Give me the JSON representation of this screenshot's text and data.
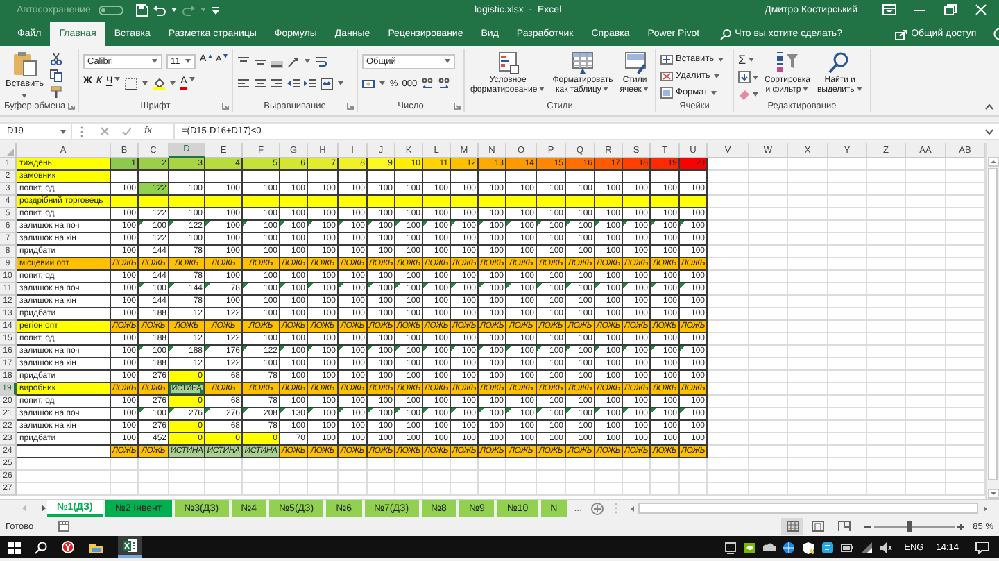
{
  "title_bar": {
    "autosave_label": "Автосохранение",
    "autosave_on": false,
    "document_title": "logistic.xlsx  -  Excel",
    "user_name": "Дмитро Костирський"
  },
  "menu_tabs": [
    {
      "label": "Файл",
      "selected": false
    },
    {
      "label": "Главная",
      "selected": true
    },
    {
      "label": "Вставка",
      "selected": false
    },
    {
      "label": "Разметка страницы",
      "selected": false
    },
    {
      "label": "Формулы",
      "selected": false
    },
    {
      "label": "Данные",
      "selected": false
    },
    {
      "label": "Рецензирование",
      "selected": false
    },
    {
      "label": "Вид",
      "selected": false
    },
    {
      "label": "Разработчик",
      "selected": false
    },
    {
      "label": "Справка",
      "selected": false
    },
    {
      "label": "Power Pivot",
      "selected": false
    }
  ],
  "tell_me": {
    "placeholder": "Что вы хотите сделать?"
  },
  "share_button": "Общий доступ",
  "ribbon": {
    "clipboard": {
      "paste": "Вставить",
      "label": "Буфер обмена"
    },
    "font": {
      "name": "Calibri",
      "size": "11",
      "grow": "A",
      "shrink": "A",
      "bold": "Ж",
      "italic": "К",
      "underline": "Ч",
      "font_color": "A",
      "label": "Шрифт"
    },
    "alignment": {
      "label": "Выравнивание"
    },
    "number": {
      "format": "Общий",
      "percent": "%",
      "thousands": "000",
      "label": "Число"
    },
    "styles": {
      "buttons": [
        "Условное\nформатирование",
        "Форматировать\nкак таблицу",
        "Стили\nячеек"
      ],
      "label": "Стили"
    },
    "cells": {
      "buttons": [
        "Вставить",
        "Удалить",
        "Формат"
      ],
      "label": "Ячейки"
    },
    "editing": {
      "sum": "Σ",
      "buttons": [
        "Сортировка\nи фильтр",
        "Найти и\nвыделить"
      ],
      "label": "Редактирование"
    }
  },
  "formula_bar": {
    "name_box": "D19",
    "fx": "fx",
    "formula": "=(D15-D16+D17)<0"
  },
  "sheet": {
    "columns": [
      {
        "label": "A",
        "selected": false
      },
      {
        "label": "B",
        "selected": false
      },
      {
        "label": "C",
        "selected": false
      },
      {
        "label": "D",
        "selected": true
      },
      {
        "label": "E",
        "selected": false
      },
      {
        "label": "F",
        "selected": false
      },
      {
        "label": "G",
        "selected": false
      },
      {
        "label": "H",
        "selected": false
      },
      {
        "label": "I",
        "selected": false
      },
      {
        "label": "J",
        "selected": false
      },
      {
        "label": "K",
        "selected": false
      },
      {
        "label": "L",
        "selected": false
      },
      {
        "label": "M",
        "selected": false
      },
      {
        "label": "N",
        "selected": false
      },
      {
        "label": "O",
        "selected": false
      },
      {
        "label": "P",
        "selected": false
      },
      {
        "label": "Q",
        "selected": false
      },
      {
        "label": "R",
        "selected": false
      },
      {
        "label": "S",
        "selected": false
      },
      {
        "label": "T",
        "selected": false
      },
      {
        "label": "U",
        "selected": false
      },
      {
        "label": "V",
        "selected": false
      },
      {
        "label": "W",
        "selected": false
      },
      {
        "label": "X",
        "selected": false
      },
      {
        "label": "Y",
        "selected": false
      },
      {
        "label": "Z",
        "selected": false
      },
      {
        "label": "AA",
        "selected": false
      },
      {
        "label": "AB",
        "selected": false
      }
    ],
    "rows": [
      {
        "number": "1",
        "selected": false,
        "kind": "header",
        "label": {
          "text": "тиждень",
          "color": "#ffff00"
        },
        "cells": [
          {
            "text": "1",
            "color": "#8dc94e"
          },
          {
            "text": "2",
            "color": "#9bcf48"
          },
          {
            "text": "3",
            "color": "#a9d543"
          },
          {
            "text": "4",
            "color": "#b8db3d"
          },
          {
            "text": "5",
            "color": "#c6e138"
          },
          {
            "text": "6",
            "color": "#d4e632"
          },
          {
            "text": "7",
            "color": "#e2ec2d"
          },
          {
            "text": "8",
            "color": "#f0f227"
          },
          {
            "text": "9",
            "color": "#fef822"
          },
          {
            "text": "10",
            "color": "#ffee00"
          },
          {
            "text": "11",
            "color": "#ffd400"
          },
          {
            "text": "12",
            "color": "#ffc000"
          },
          {
            "text": "13",
            "color": "#ffaa00"
          },
          {
            "text": "14",
            "color": "#ff9900"
          },
          {
            "text": "15",
            "color": "#ff8800"
          },
          {
            "text": "16",
            "color": "#ff7000"
          },
          {
            "text": "17",
            "color": "#ff5a00"
          },
          {
            "text": "18",
            "color": "#ff4000"
          },
          {
            "text": "19",
            "color": "#ff2a00"
          },
          {
            "text": "20",
            "color": "#ff0000"
          }
        ]
      },
      {
        "number": "2",
        "selected": false,
        "kind": "section",
        "label": {
          "text": "замовник",
          "color": "#ffff00"
        }
      },
      {
        "number": "3",
        "selected": false,
        "kind": "data",
        "label": "попит, од",
        "cells": [
          "100",
          {
            "text": "122",
            "color": "#92d050"
          },
          "100",
          "100",
          "100",
          "100",
          "100",
          "100",
          "100",
          "100",
          "100",
          "100",
          "100",
          "100",
          "100",
          "100",
          "100",
          "100",
          "100",
          "100"
        ]
      },
      {
        "number": "4",
        "selected": false,
        "kind": "section",
        "label": {
          "text": "роздрібний торговець",
          "color": "#ffff00"
        },
        "color": "#ffff00"
      },
      {
        "number": "5",
        "selected": false,
        "kind": "data",
        "label": "попит, од",
        "cells": [
          "100",
          "122",
          "100",
          "100",
          "100",
          "100",
          "100",
          "100",
          "100",
          "100",
          "100",
          "100",
          "100",
          "100",
          "100",
          "100",
          "100",
          "100",
          "100",
          "100"
        ]
      },
      {
        "number": "6",
        "selected": false,
        "kind": "data",
        "label": "залишок на поч",
        "error_marks": true,
        "cells": [
          "100",
          "100",
          "122",
          "100",
          "100",
          "100",
          "100",
          "100",
          "100",
          "100",
          "100",
          "100",
          "100",
          "100",
          "100",
          "100",
          "100",
          "100",
          "100",
          "100"
        ]
      },
      {
        "number": "7",
        "selected": false,
        "kind": "data",
        "label": "залишок на кін",
        "cells": [
          "100",
          "122",
          "100",
          "100",
          "100",
          "100",
          "100",
          "100",
          "100",
          "100",
          "100",
          "100",
          "100",
          "100",
          "100",
          "100",
          "100",
          "100",
          "100",
          "100"
        ]
      },
      {
        "number": "8",
        "selected": false,
        "kind": "data",
        "label": "придбати",
        "cells": [
          "100",
          "144",
          "78",
          "100",
          "100",
          "100",
          "100",
          "100",
          "100",
          "100",
          "100",
          "100",
          "100",
          "100",
          "100",
          "100",
          "100",
          "100",
          "100",
          "100"
        ]
      },
      {
        "number": "9",
        "selected": false,
        "kind": "check",
        "label": {
          "text": "місцевий опт",
          "color": "#ffc000"
        },
        "color": "#ffc000",
        "cells": [
          "ЛОЖЬ",
          "ЛОЖЬ",
          "ЛОЖЬ",
          "ЛОЖЬ",
          "ЛОЖЬ",
          "ЛОЖЬ",
          "ЛОЖЬ",
          "ЛОЖЬ",
          "ЛОЖЬ",
          "ЛОЖЬ",
          "ЛОЖЬ",
          "ЛОЖЬ",
          "ЛОЖЬ",
          "ЛОЖЬ",
          "ЛОЖЬ",
          "ЛОЖЬ",
          "ЛОЖЬ",
          "ЛОЖЬ",
          "ЛОЖЬ",
          "ЛОЖЬ"
        ]
      },
      {
        "number": "10",
        "selected": false,
        "kind": "data",
        "label": "попит, од",
        "cells": [
          "100",
          "144",
          "78",
          "100",
          "100",
          "100",
          "100",
          "100",
          "100",
          "100",
          "100",
          "100",
          "100",
          "100",
          "100",
          "100",
          "100",
          "100",
          "100",
          "100"
        ]
      },
      {
        "number": "11",
        "selected": false,
        "kind": "data",
        "label": "залишок на поч",
        "error_marks": true,
        "cells": [
          "100",
          "100",
          "144",
          "78",
          "100",
          "100",
          "100",
          "100",
          "100",
          "100",
          "100",
          "100",
          "100",
          "100",
          "100",
          "100",
          "100",
          "100",
          "100",
          "100"
        ]
      },
      {
        "number": "12",
        "selected": false,
        "kind": "data",
        "label": "залишок на кін",
        "cells": [
          "100",
          "144",
          "78",
          "100",
          "100",
          "100",
          "100",
          "100",
          "100",
          "100",
          "100",
          "100",
          "100",
          "100",
          "100",
          "100",
          "100",
          "100",
          "100",
          "100"
        ]
      },
      {
        "number": "13",
        "selected": false,
        "kind": "data",
        "label": "придбати",
        "cells": [
          "100",
          "188",
          "12",
          "122",
          "100",
          "100",
          "100",
          "100",
          "100",
          "100",
          "100",
          "100",
          "100",
          "100",
          "100",
          "100",
          "100",
          "100",
          "100",
          "100"
        ]
      },
      {
        "number": "14",
        "selected": false,
        "kind": "check",
        "label": {
          "text": "регіон опт",
          "color": "#ffff00"
        },
        "color": "#ffc000",
        "cells": [
          "ЛОЖЬ",
          "ЛОЖЬ",
          "ЛОЖЬ",
          "ЛОЖЬ",
          "ЛОЖЬ",
          "ЛОЖЬ",
          "ЛОЖЬ",
          "ЛОЖЬ",
          "ЛОЖЬ",
          "ЛОЖЬ",
          "ЛОЖЬ",
          "ЛОЖЬ",
          "ЛОЖЬ",
          "ЛОЖЬ",
          "ЛОЖЬ",
          "ЛОЖЬ",
          "ЛОЖЬ",
          "ЛОЖЬ",
          "ЛОЖЬ",
          "ЛОЖЬ"
        ]
      },
      {
        "number": "15",
        "selected": false,
        "kind": "data",
        "label": "попит, од",
        "cells": [
          "100",
          "188",
          "12",
          "122",
          "100",
          "100",
          "100",
          "100",
          "100",
          "100",
          "100",
          "100",
          "100",
          "100",
          "100",
          "100",
          "100",
          "100",
          "100",
          "100"
        ]
      },
      {
        "number": "16",
        "selected": false,
        "kind": "data",
        "label": "залишок на поч",
        "error_marks": true,
        "cells": [
          "100",
          "100",
          "188",
          "176",
          "122",
          "100",
          "100",
          "100",
          "100",
          "100",
          "100",
          "100",
          "100",
          "100",
          "100",
          "100",
          "100",
          "100",
          "100",
          "100"
        ]
      },
      {
        "number": "17",
        "selected": false,
        "kind": "data",
        "label": "залишок на кін",
        "cells": [
          "100",
          "188",
          "12",
          "122",
          "100",
          "100",
          "100",
          "100",
          "100",
          "100",
          "100",
          "100",
          "100",
          "100",
          "100",
          "100",
          "100",
          "100",
          "100",
          "100"
        ]
      },
      {
        "number": "18",
        "selected": false,
        "kind": "data",
        "label": "придбати",
        "cells": [
          "100",
          "276",
          {
            "text": "0",
            "color": "#ffff00"
          },
          "68",
          "78",
          "100",
          "100",
          "100",
          "100",
          "100",
          "100",
          "100",
          "100",
          "100",
          "100",
          "100",
          "100",
          "100",
          "100",
          "100"
        ]
      },
      {
        "number": "19",
        "selected": true,
        "kind": "check",
        "label": {
          "text": "виробник",
          "color": "#ffff00"
        },
        "color": "#ffc000",
        "cells": [
          "ЛОЖЬ",
          "ЛОЖЬ",
          {
            "text": "ИСТИНА",
            "color": "#a9d08e"
          },
          "ЛОЖЬ",
          "ЛОЖЬ",
          "ЛОЖЬ",
          "ЛОЖЬ",
          "ЛОЖЬ",
          "ЛОЖЬ",
          "ЛОЖЬ",
          "ЛОЖЬ",
          "ЛОЖЬ",
          "ЛОЖЬ",
          "ЛОЖЬ",
          "ЛОЖЬ",
          "ЛОЖЬ",
          "ЛОЖЬ",
          "ЛОЖЬ",
          "ЛОЖЬ",
          "ЛОЖЬ"
        ]
      },
      {
        "number": "20",
        "selected": false,
        "kind": "data",
        "label": "попит, од",
        "cells": [
          "100",
          "276",
          {
            "text": "0",
            "color": "#ffff00"
          },
          "68",
          "78",
          "100",
          "100",
          "100",
          "100",
          "100",
          "100",
          "100",
          "100",
          "100",
          "100",
          "100",
          "100",
          "100",
          "100",
          "100"
        ]
      },
      {
        "number": "21",
        "selected": false,
        "kind": "data",
        "label": "залишок на поч",
        "error_marks": true,
        "cells": [
          "100",
          "100",
          "276",
          "276",
          "208",
          "130",
          "100",
          "100",
          "100",
          "100",
          "100",
          "100",
          "100",
          "100",
          "100",
          "100",
          "100",
          "100",
          "100",
          "100"
        ]
      },
      {
        "number": "22",
        "selected": false,
        "kind": "data",
        "label": "залишок на кін",
        "cells": [
          "100",
          "276",
          {
            "text": "0",
            "color": "#ffff00"
          },
          "68",
          "78",
          "100",
          "100",
          "100",
          "100",
          "100",
          "100",
          "100",
          "100",
          "100",
          "100",
          "100",
          "100",
          "100",
          "100",
          "100"
        ]
      },
      {
        "number": "23",
        "selected": false,
        "kind": "data",
        "label": "придбати",
        "cells": [
          "100",
          "452",
          {
            "text": "0",
            "color": "#ffff00"
          },
          {
            "text": "0",
            "color": "#ffff00"
          },
          {
            "text": "0",
            "color": "#ffff00"
          },
          "70",
          "100",
          "100",
          "100",
          "100",
          "100",
          "100",
          "100",
          "100",
          "100",
          "100",
          "100",
          "100",
          "100",
          "100"
        ]
      },
      {
        "number": "24",
        "selected": false,
        "kind": "check",
        "color": "#ffc000",
        "cells": [
          "ЛОЖЬ",
          "ЛОЖЬ",
          {
            "text": "ИСТИНА",
            "color": "#a9d08e"
          },
          {
            "text": "ИСТИНА",
            "color": "#a9d08e"
          },
          {
            "text": "ИСТИНА",
            "color": "#a9d08e"
          },
          "ЛОЖЬ",
          "ЛОЖЬ",
          "ЛОЖЬ",
          "ЛОЖЬ",
          "ЛОЖЬ",
          "ЛОЖЬ",
          "ЛОЖЬ",
          "ЛОЖЬ",
          "ЛОЖЬ",
          "ЛОЖЬ",
          "ЛОЖЬ",
          "ЛОЖЬ",
          "ЛОЖЬ",
          "ЛОЖЬ",
          "ЛОЖЬ"
        ]
      },
      {
        "number": "25",
        "selected": false,
        "kind": "blank"
      },
      {
        "number": "26",
        "selected": false,
        "kind": "blank"
      },
      {
        "number": "27",
        "selected": false,
        "kind": "blank"
      }
    ]
  },
  "sheet_tabs": [
    {
      "label": "№1(ДЗ)",
      "selected": true,
      "color": "#00b050"
    },
    {
      "label": "№2 Інвент",
      "selected": false,
      "color": "#00b050"
    },
    {
      "label": "№3(ДЗ)",
      "selected": false,
      "color": "#92d050"
    },
    {
      "label": "№4",
      "selected": false,
      "color": "#92d050"
    },
    {
      "label": "№5(ДЗ)",
      "selected": false,
      "color": "#92d050"
    },
    {
      "label": "№6",
      "selected": false,
      "color": "#92d050"
    },
    {
      "label": "№7(ДЗ)",
      "selected": false,
      "color": "#92d050"
    },
    {
      "label": "№8",
      "selected": false,
      "color": "#92d050"
    },
    {
      "label": "№9",
      "selected": false,
      "color": "#92d050"
    },
    {
      "label": "№10",
      "selected": false,
      "color": "#92d050"
    },
    {
      "label": "N",
      "selected": false,
      "color": "#92d050"
    }
  ],
  "more_tabs": "...",
  "status_bar": {
    "status": "Готово",
    "zoom": "85 %",
    "zoom_slider": {
      "level": 0.43
    }
  },
  "taskbar": {
    "language": "ENG",
    "time": "14:14"
  }
}
